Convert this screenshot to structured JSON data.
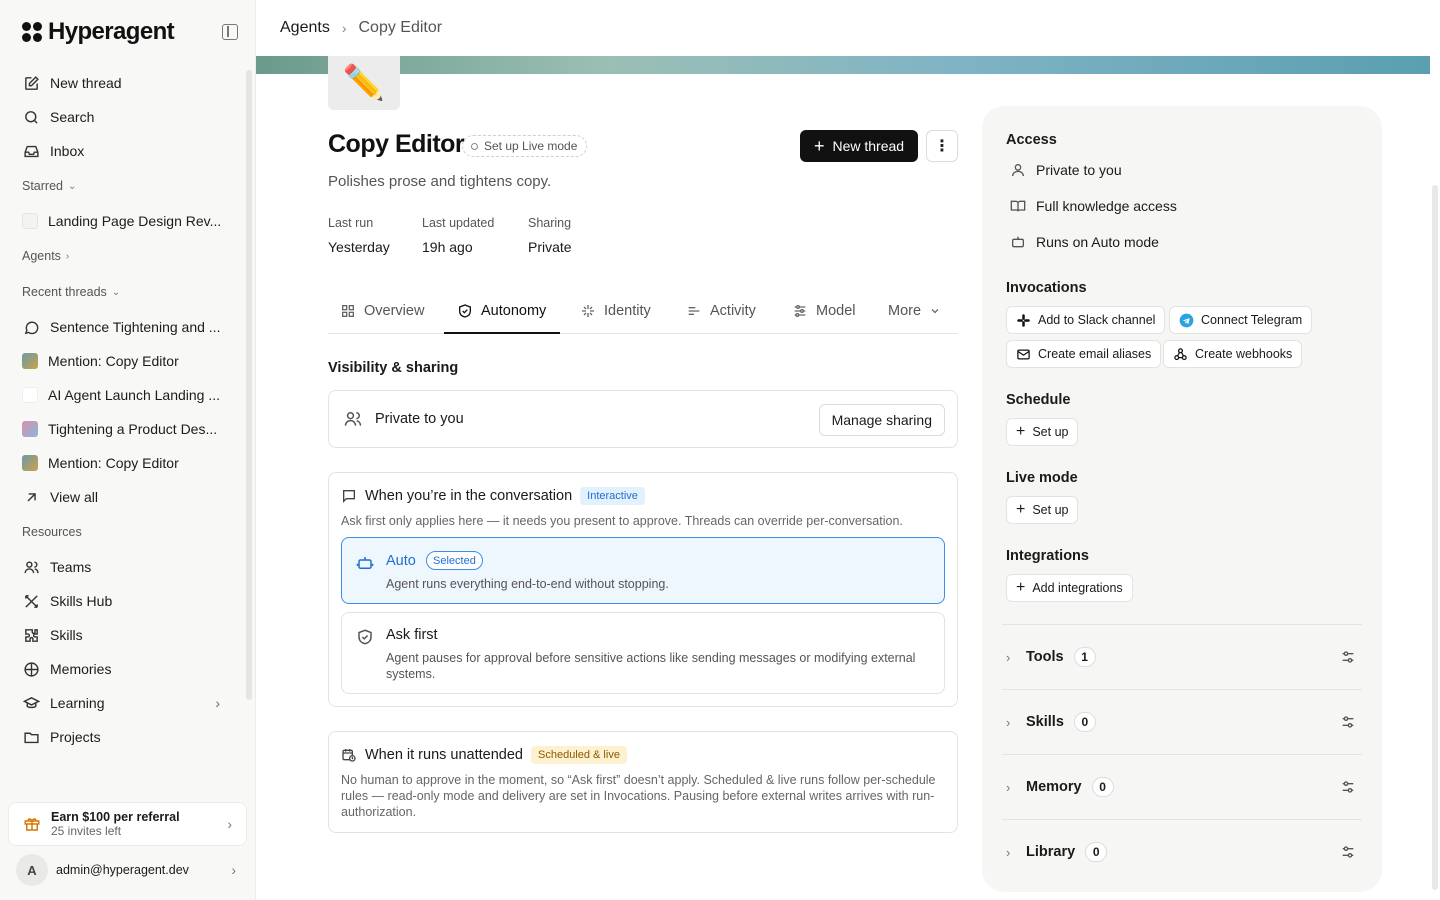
{
  "brand": {
    "name": "Hyperagent"
  },
  "sidebar": {
    "top_items": [
      {
        "label": "New thread",
        "icon": "edit-icon"
      },
      {
        "label": "Search",
        "icon": "search-icon"
      },
      {
        "label": "Inbox",
        "icon": "inbox-icon"
      }
    ],
    "starred_label": "Starred",
    "starred_items": [
      {
        "label": "Landing Page Design Rev..."
      }
    ],
    "agents_label": "Agents",
    "recent_label": "Recent threads",
    "recent_items": [
      {
        "label": "Sentence Tightening and ...",
        "icon": "chat-bubble-icon"
      },
      {
        "label": "Mention: Copy Editor",
        "icon": "pencil-thumb-icon"
      },
      {
        "label": "AI Agent Launch Landing ...",
        "icon": "blank-thumb-icon"
      },
      {
        "label": "Tightening a Product Des...",
        "icon": "magnifier-thumb-icon"
      },
      {
        "label": "Mention: Copy Editor",
        "icon": "pencil-thumb-icon"
      }
    ],
    "view_all": "View all",
    "resources_label": "Resources",
    "resource_items": [
      {
        "label": "Teams",
        "icon": "users-icon"
      },
      {
        "label": "Skills Hub",
        "icon": "skills-hub-icon"
      },
      {
        "label": "Skills",
        "icon": "puzzle-icon"
      },
      {
        "label": "Memories",
        "icon": "brain-icon"
      },
      {
        "label": "Learning",
        "icon": "graduation-cap-icon"
      },
      {
        "label": "Projects",
        "icon": "folder-icon"
      }
    ],
    "referral": {
      "title": "Earn $100 per referral",
      "subtitle": "25 invites left"
    },
    "account": {
      "initial": "A",
      "email": "admin@hyperagent.dev"
    }
  },
  "breadcrumb": {
    "root": "Agents",
    "current": "Copy Editor"
  },
  "agent": {
    "emoji": "✏️",
    "name": "Copy Editor",
    "live_mode_pill": "Set up Live mode",
    "new_thread_label": "New thread",
    "description": "Polishes prose and tightens copy.",
    "meta": [
      {
        "key": "Last run",
        "value": "Yesterday"
      },
      {
        "key": "Last updated",
        "value": "19h ago"
      },
      {
        "key": "Sharing",
        "value": "Private"
      }
    ]
  },
  "tabs": [
    {
      "label": "Overview",
      "icon": "grid-icon"
    },
    {
      "label": "Autonomy",
      "icon": "shield-check-icon",
      "active": true
    },
    {
      "label": "Identity",
      "icon": "sparkle-icon"
    },
    {
      "label": "Activity",
      "icon": "activity-list-icon"
    },
    {
      "label": "Model",
      "icon": "sliders-icon"
    },
    {
      "label": "More",
      "icon": "chevron-down-icon"
    }
  ],
  "visibility": {
    "title": "Visibility & sharing",
    "status": "Private to you",
    "manage_label": "Manage sharing"
  },
  "conversation": {
    "title": "When you’re in the conversation",
    "badge": "Interactive",
    "subtitle": "Ask first only applies here — it needs you present to approve. Threads can override per-conversation.",
    "options": [
      {
        "title": "Auto",
        "badge": "Selected",
        "description": "Agent runs everything end-to-end without stopping."
      },
      {
        "title": "Ask first",
        "description": "Agent pauses for approval before sensitive actions like sending messages or modifying external systems."
      }
    ]
  },
  "unattended": {
    "title": "When it runs unattended",
    "badge": "Scheduled & live",
    "description": "No human to approve in the moment, so “Ask first” doesn’t apply. Scheduled & live runs follow per-schedule rules — read-only mode and delivery are set in Invocations. Pausing before external writes arrives with run-authorization."
  },
  "right_panel": {
    "access_title": "Access",
    "access_items": [
      {
        "label": "Private to you",
        "icon": "user-icon"
      },
      {
        "label": "Full knowledge access",
        "icon": "book-icon"
      },
      {
        "label": "Runs on Auto mode",
        "icon": "robot-icon"
      }
    ],
    "invocations_title": "Invocations",
    "invocation_chips": [
      {
        "label": "Add to Slack channel",
        "icon": "slack-icon"
      },
      {
        "label": "Connect Telegram",
        "icon": "telegram-icon"
      },
      {
        "label": "Create email aliases",
        "icon": "mail-icon"
      },
      {
        "label": "Create webhooks",
        "icon": "webhook-icon"
      }
    ],
    "schedule_title": "Schedule",
    "schedule_btn": "Set up",
    "live_title": "Live mode",
    "live_btn": "Set up",
    "integrations_title": "Integrations",
    "integrations_btn": "Add integrations",
    "sections": [
      {
        "name": "Tools",
        "count": "1"
      },
      {
        "name": "Skills",
        "count": "0"
      },
      {
        "name": "Memory",
        "count": "0"
      },
      {
        "name": "Library",
        "count": "0"
      }
    ]
  },
  "colors": {
    "accent_blue": "#3b8ee8",
    "primary_dark": "#111111",
    "badge_yellow": "#fdf1cf"
  }
}
